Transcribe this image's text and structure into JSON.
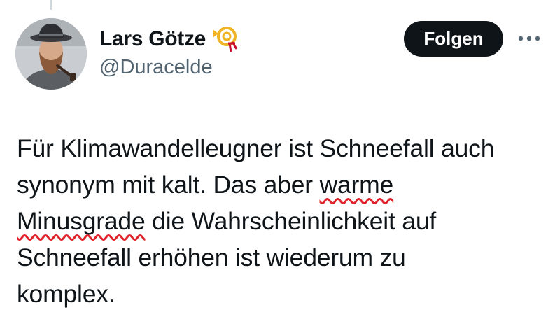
{
  "tweet": {
    "author": {
      "display_name": "Lars Götze",
      "handle": "@Duracelde",
      "badge_icon": "posthorn-icon",
      "avatar_icon": "profile-photo"
    },
    "follow_label": "Folgen",
    "more_icon": "more-dots-icon",
    "text": {
      "line1": "Für Klimawandelleugner ist Schneefall auch",
      "line2_pre": "synonym mit kalt. Das aber ",
      "line2_err": "warme",
      "line3_err": "Minusgrade",
      "line3_post": " die Wahrscheinlichkeit auf",
      "line4": "Schneefall erhöhen ist wiederum zu",
      "line5": "komplex."
    },
    "colors": {
      "text": "#0f1419",
      "secondary": "#536471",
      "follow_bg": "#0f1419",
      "spell_underline": "#e0242e"
    }
  }
}
